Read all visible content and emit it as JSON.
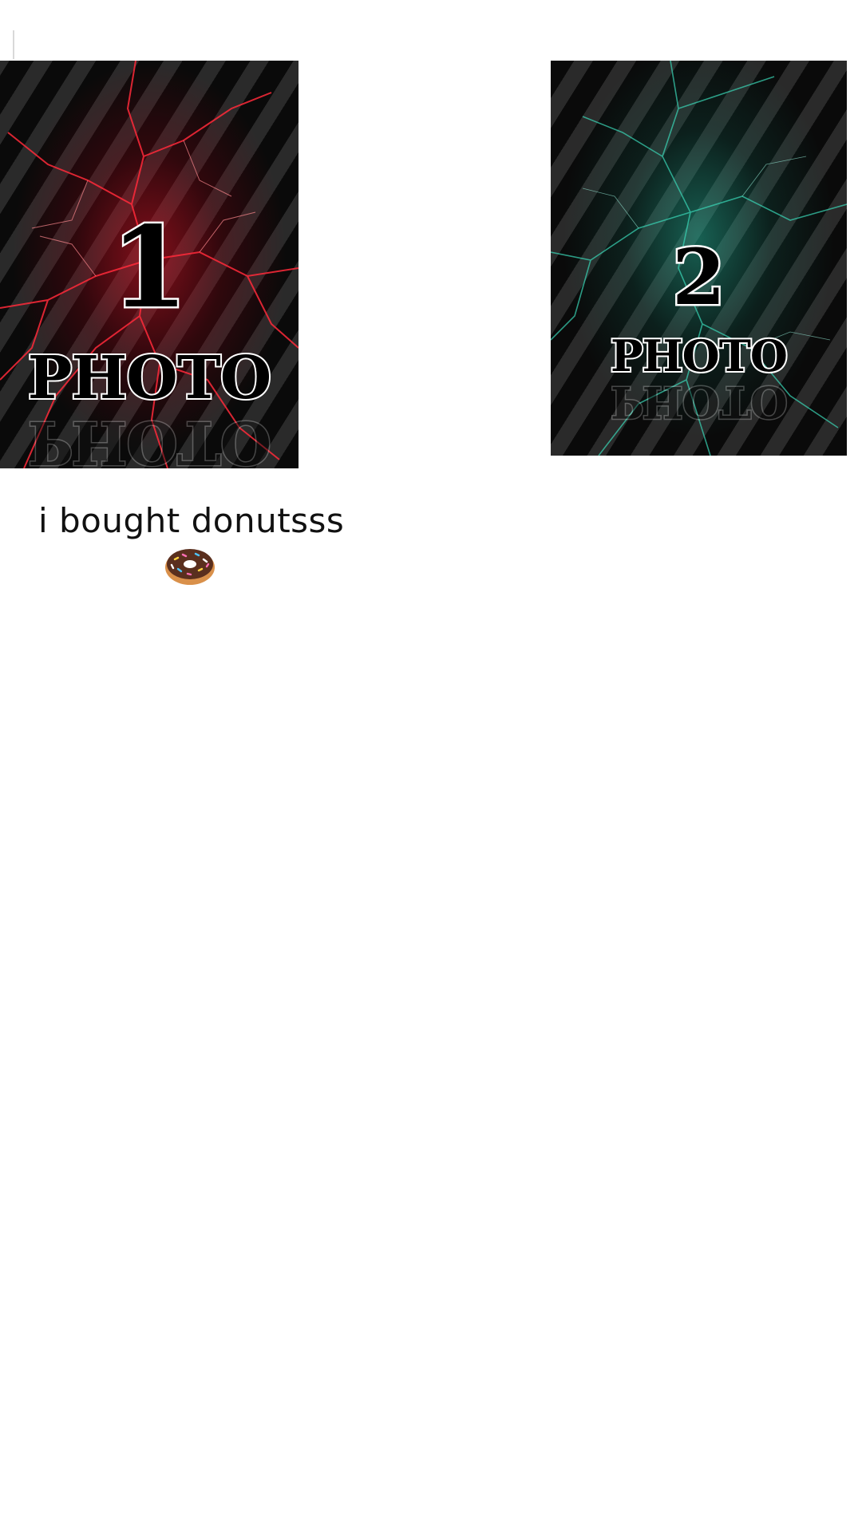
{
  "cards": [
    {
      "number": "1",
      "word": "PHOTO",
      "accent": "#e0142a"
    },
    {
      "number": "2",
      "word": "PHOTO",
      "accent": "#2ecfb0"
    }
  ],
  "caption": {
    "text": "i bought donutsss",
    "icon": "donut-icon"
  }
}
